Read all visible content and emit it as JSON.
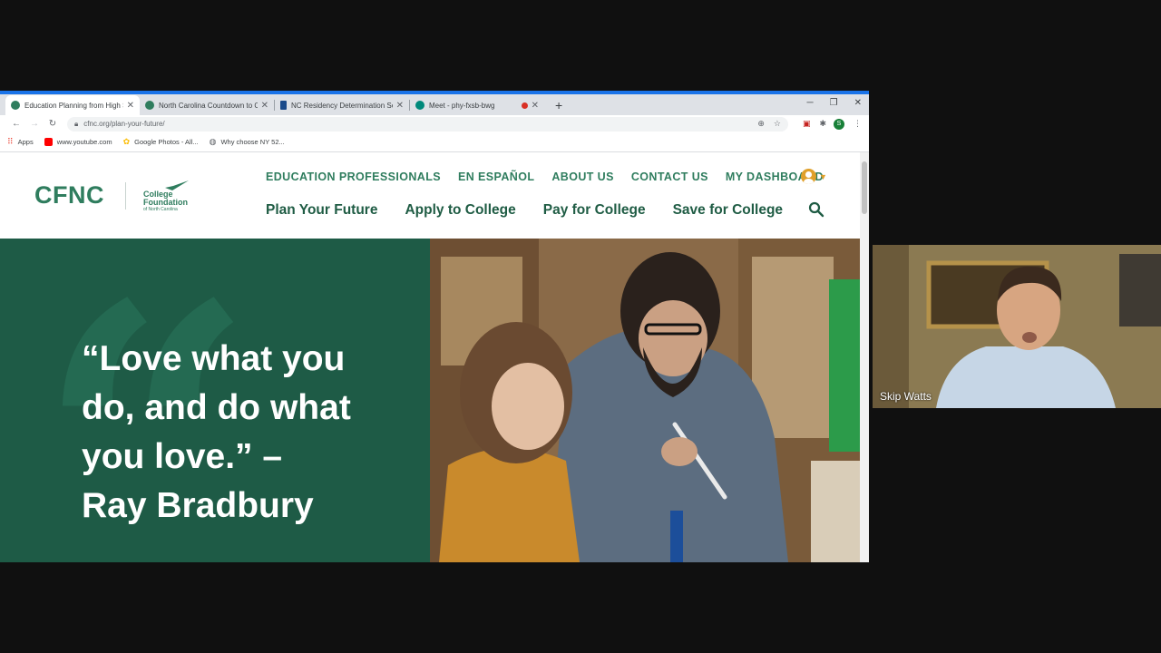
{
  "browser": {
    "tabs": [
      {
        "title": "Education Planning from High Sc",
        "active": true,
        "favicon_color": "#2f7d5e"
      },
      {
        "title": "North Carolina Countdown to Co",
        "active": false,
        "favicon_color": "#2f7d5e"
      },
      {
        "title": "NC Residency Determination Ser",
        "active": false,
        "favicon_color": "#1a4a8a"
      },
      {
        "title": "Meet - phy-fxsb-bwg",
        "active": false,
        "favicon_color": "#00897b",
        "recording": true
      }
    ],
    "new_tab": "+",
    "url": "cfnc.org/plan-your-future/",
    "profile_initial": "S",
    "bookmarks": [
      {
        "label": "Apps",
        "icon_color": "#ea4335"
      },
      {
        "label": "www.youtube.com",
        "icon_color": "#ff0000"
      },
      {
        "label": "Google Photos - All...",
        "icon_color": "#fbbc04"
      },
      {
        "label": "Why choose NY 52...",
        "icon_color": "#5f6368"
      }
    ]
  },
  "site": {
    "logo": "CFNC",
    "logo_sub": [
      "College",
      "Foundation",
      "of North Carolina"
    ],
    "util_nav": [
      "EDUCATION PROFESSIONALS",
      "EN ESPAÑOL",
      "ABOUT US",
      "CONTACT US",
      "MY DASHBOARD"
    ],
    "main_nav": [
      "Plan Your Future",
      "Apply to College",
      "Pay for College",
      "Save for College"
    ],
    "hero_quote": "“Love what you do, and do what you love.” – Ray Bradbury",
    "colors": {
      "brand_green": "#2f7d5e",
      "hero_green": "#1e5b46",
      "accent_gold": "#e0a02a"
    }
  },
  "video": {
    "participant_name": "Skip Watts"
  }
}
